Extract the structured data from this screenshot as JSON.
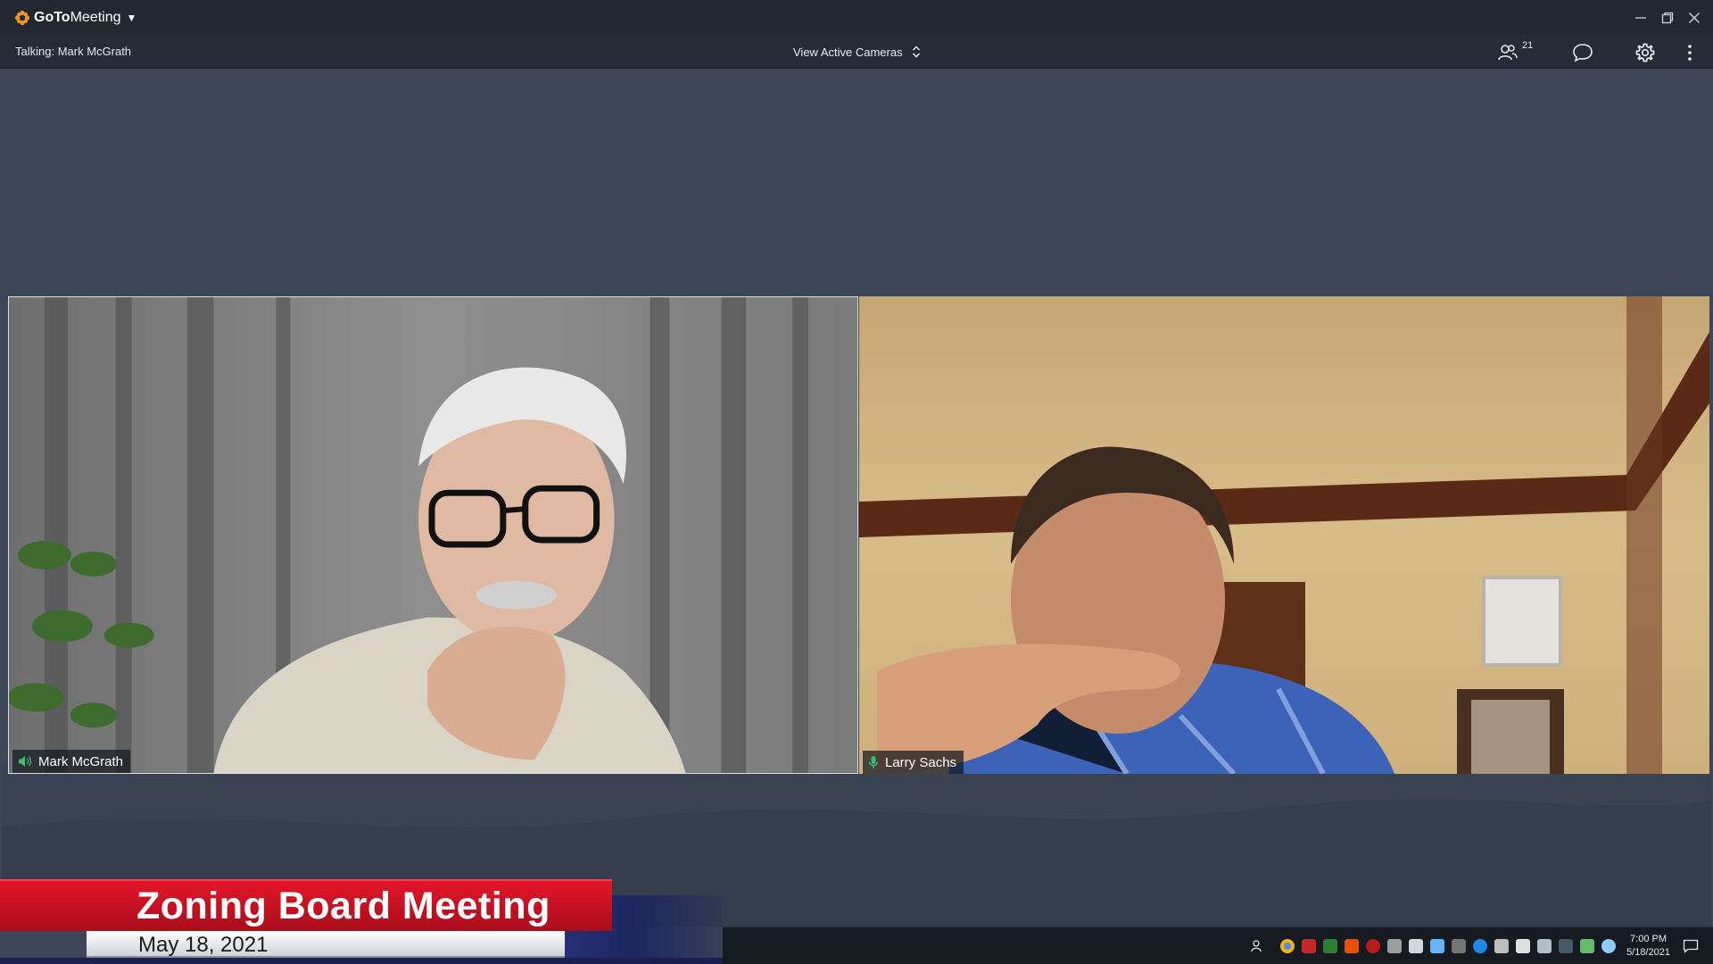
{
  "app": {
    "brand_bold": "GoTo",
    "brand_regular": "Meeting"
  },
  "toolbar": {
    "talking_label": "Talking: Mark McGrath",
    "view_label": "View Active Cameras",
    "attendee_count": "21"
  },
  "participants": [
    {
      "name": "Mark McGrath",
      "status_icon": "speaker-icon"
    },
    {
      "name": "Larry Sachs",
      "status_icon": "microphone-icon"
    }
  ],
  "lower_third": {
    "title": "Zoning Board Meeting",
    "date": "May 18, 2021"
  },
  "taskbar": {
    "time": "7:00 PM",
    "date": "5/18/2021"
  },
  "colors": {
    "accent_orange": "#f7941d",
    "mic_green": "#38c172",
    "banner_red": "#d9142a"
  }
}
